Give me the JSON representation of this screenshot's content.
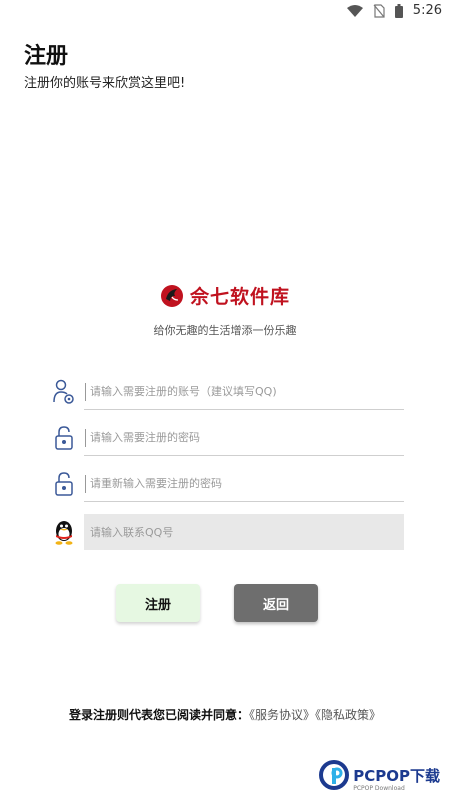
{
  "status_bar": {
    "time": "5:26",
    "icons": [
      "wifi-icon",
      "no-sim-icon",
      "battery-icon"
    ]
  },
  "header": {
    "title": "注册",
    "subtitle": "注册你的账号来欣赏这里吧!"
  },
  "brand": {
    "name": "佘七软件库",
    "tagline": "给你无趣的生活增添一份乐趣",
    "color": "#c0121f"
  },
  "form": {
    "account": {
      "placeholder": "请输入需要注册的账号（建议填写QQ)",
      "icon": "user-settings-icon"
    },
    "password": {
      "placeholder": "请输入需要注册的密码",
      "icon": "lock-icon"
    },
    "confirm_password": {
      "placeholder": "请重新输入需要注册的密码",
      "icon": "lock-icon"
    },
    "qq": {
      "placeholder": "请输入联系QQ号",
      "icon": "qq-penguin-icon"
    }
  },
  "buttons": {
    "register": "注册",
    "back": "返回"
  },
  "agreement": {
    "lead": "登录注册则代表您已阅读并同意：",
    "service": "《服务协议》",
    "privacy": "《隐私政策》"
  },
  "watermark": {
    "text": "PCPOP下载",
    "sub": "PCPOP Download"
  },
  "colors": {
    "register_button": "#e6f8e2",
    "back_button": "#6e6e6e",
    "accent_blue": "#1c3a8f"
  }
}
